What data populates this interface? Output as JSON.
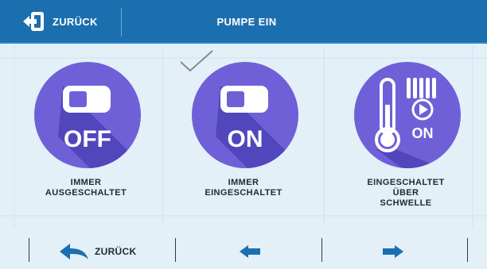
{
  "header": {
    "back_label": "ZURÜCK",
    "title": "PUMPE EIN"
  },
  "options": [
    {
      "caption_lines": [
        "IMMER",
        "AUSGESCHALTET"
      ],
      "icon_text": "OFF",
      "selected": false
    },
    {
      "caption_lines": [
        "IMMER",
        "EINGESCHALTET"
      ],
      "icon_text": "ON",
      "selected": true
    },
    {
      "caption_lines": [
        "EINGESCHALTET",
        "ÜBER",
        "SCHWELLE"
      ],
      "icon_text": "ON",
      "selected": false
    }
  ],
  "bottom_bar": {
    "back_label": "ZURÜCK"
  },
  "colors": {
    "header_bg": "#1c6fae",
    "screen_bg": "#e3f0f8",
    "circle": "#6f60d8",
    "circle_shadow": "#4e42b8",
    "arrow": "#1c6fae"
  }
}
